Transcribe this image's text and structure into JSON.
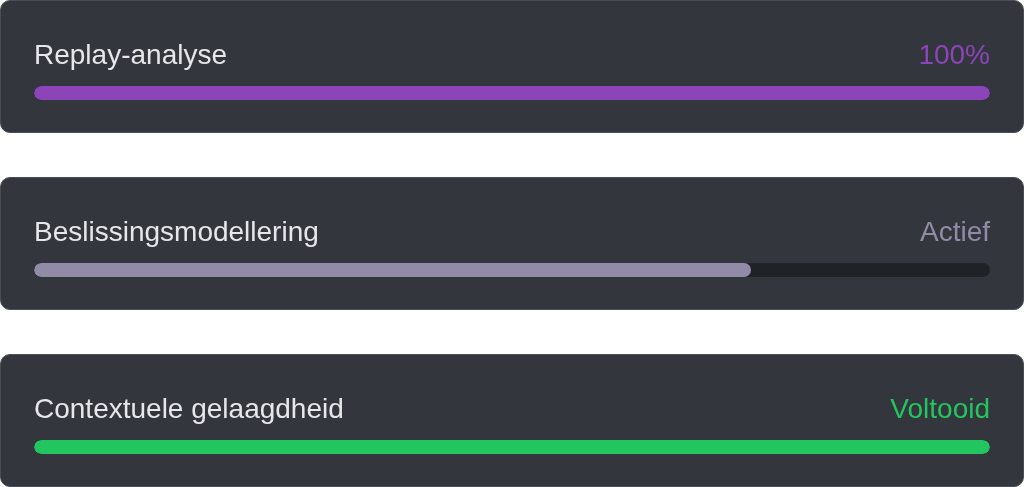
{
  "tasks": [
    {
      "label": "Replay-analyse",
      "status": "100%",
      "level": 1,
      "color": "#8b45b9"
    },
    {
      "label": "Beslissingsmodellering",
      "status": "Actief",
      "level": 0.75,
      "color": "#928ba8"
    },
    {
      "label": "Contextuele gelaagdheid",
      "status": "Voltooid",
      "level": 1,
      "color": "#22c55e"
    }
  ]
}
